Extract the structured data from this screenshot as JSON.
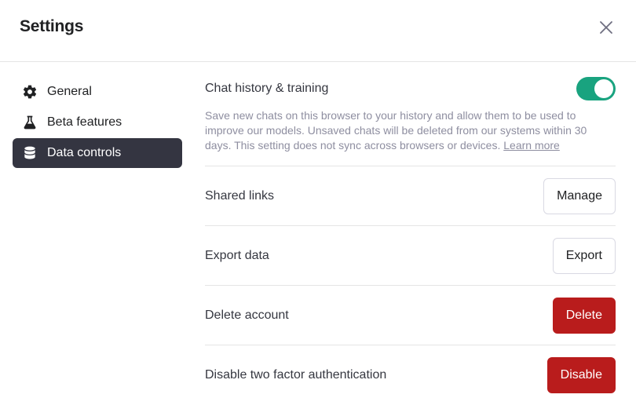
{
  "header": {
    "title": "Settings",
    "close_icon": "close-icon"
  },
  "sidebar": {
    "items": [
      {
        "label": "General",
        "icon": "gear-icon",
        "active": false
      },
      {
        "label": "Beta features",
        "icon": "flask-icon",
        "active": false
      },
      {
        "label": "Data controls",
        "icon": "database-icon",
        "active": true
      }
    ]
  },
  "content": {
    "chat_history": {
      "label": "Chat history & training",
      "enabled": true,
      "description": "Save new chats on this browser to your history and allow them to be used to improve our models. Unsaved chats will be deleted from our systems within 30 days. This setting does not sync across browsers or devices.",
      "link": "Learn more"
    },
    "shared_links": {
      "label": "Shared links",
      "button": "Manage"
    },
    "export_data": {
      "label": "Export data",
      "button": "Export"
    },
    "delete_account": {
      "label": "Delete account",
      "button": "Delete"
    },
    "two_factor": {
      "label": "Disable two factor authentication",
      "button": "Disable"
    }
  },
  "colors": {
    "toggle_on": "#19a37f",
    "danger": "#b91c1c",
    "active_nav": "#343541"
  }
}
